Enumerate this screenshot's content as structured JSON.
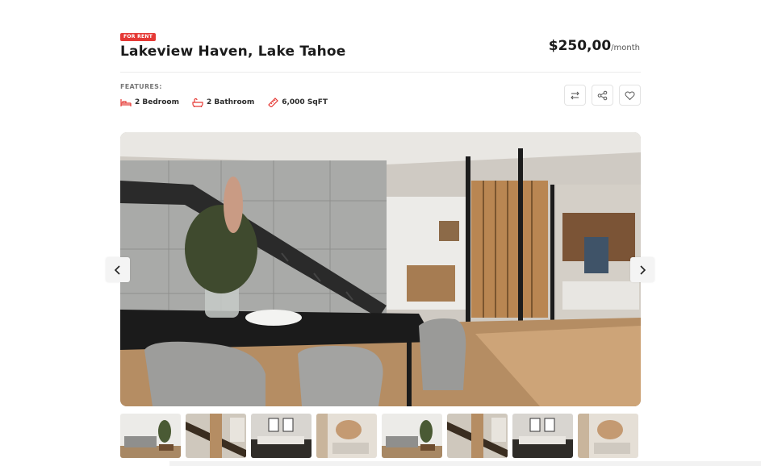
{
  "listing": {
    "status_badge": "FOR RENT",
    "title": "Lakeview Haven, Lake Tahoe",
    "price": "$250,00",
    "price_period": "/month"
  },
  "features": {
    "label": "FEATURES:",
    "items": [
      {
        "icon": "bed-icon",
        "label": "2 Bedroom"
      },
      {
        "icon": "bathtub-icon",
        "label": "2 Bathroom"
      },
      {
        "icon": "ruler-icon",
        "label": "6,000 SqFT"
      }
    ]
  },
  "actions": [
    {
      "icon": "compare-arrows-icon"
    },
    {
      "icon": "share-icon"
    },
    {
      "icon": "heart-icon"
    }
  ],
  "gallery": {
    "main_image": "modern-interior-dining-staircase",
    "thumbnails": [
      "living-room",
      "staircase-hall",
      "bedroom-art",
      "living-sofa",
      "living-room",
      "staircase-hall",
      "bedroom-art",
      "living-sofa"
    ]
  },
  "colors": {
    "accent": "#e53935",
    "text": "#1b1b1b",
    "border": "#e3e3e3"
  }
}
